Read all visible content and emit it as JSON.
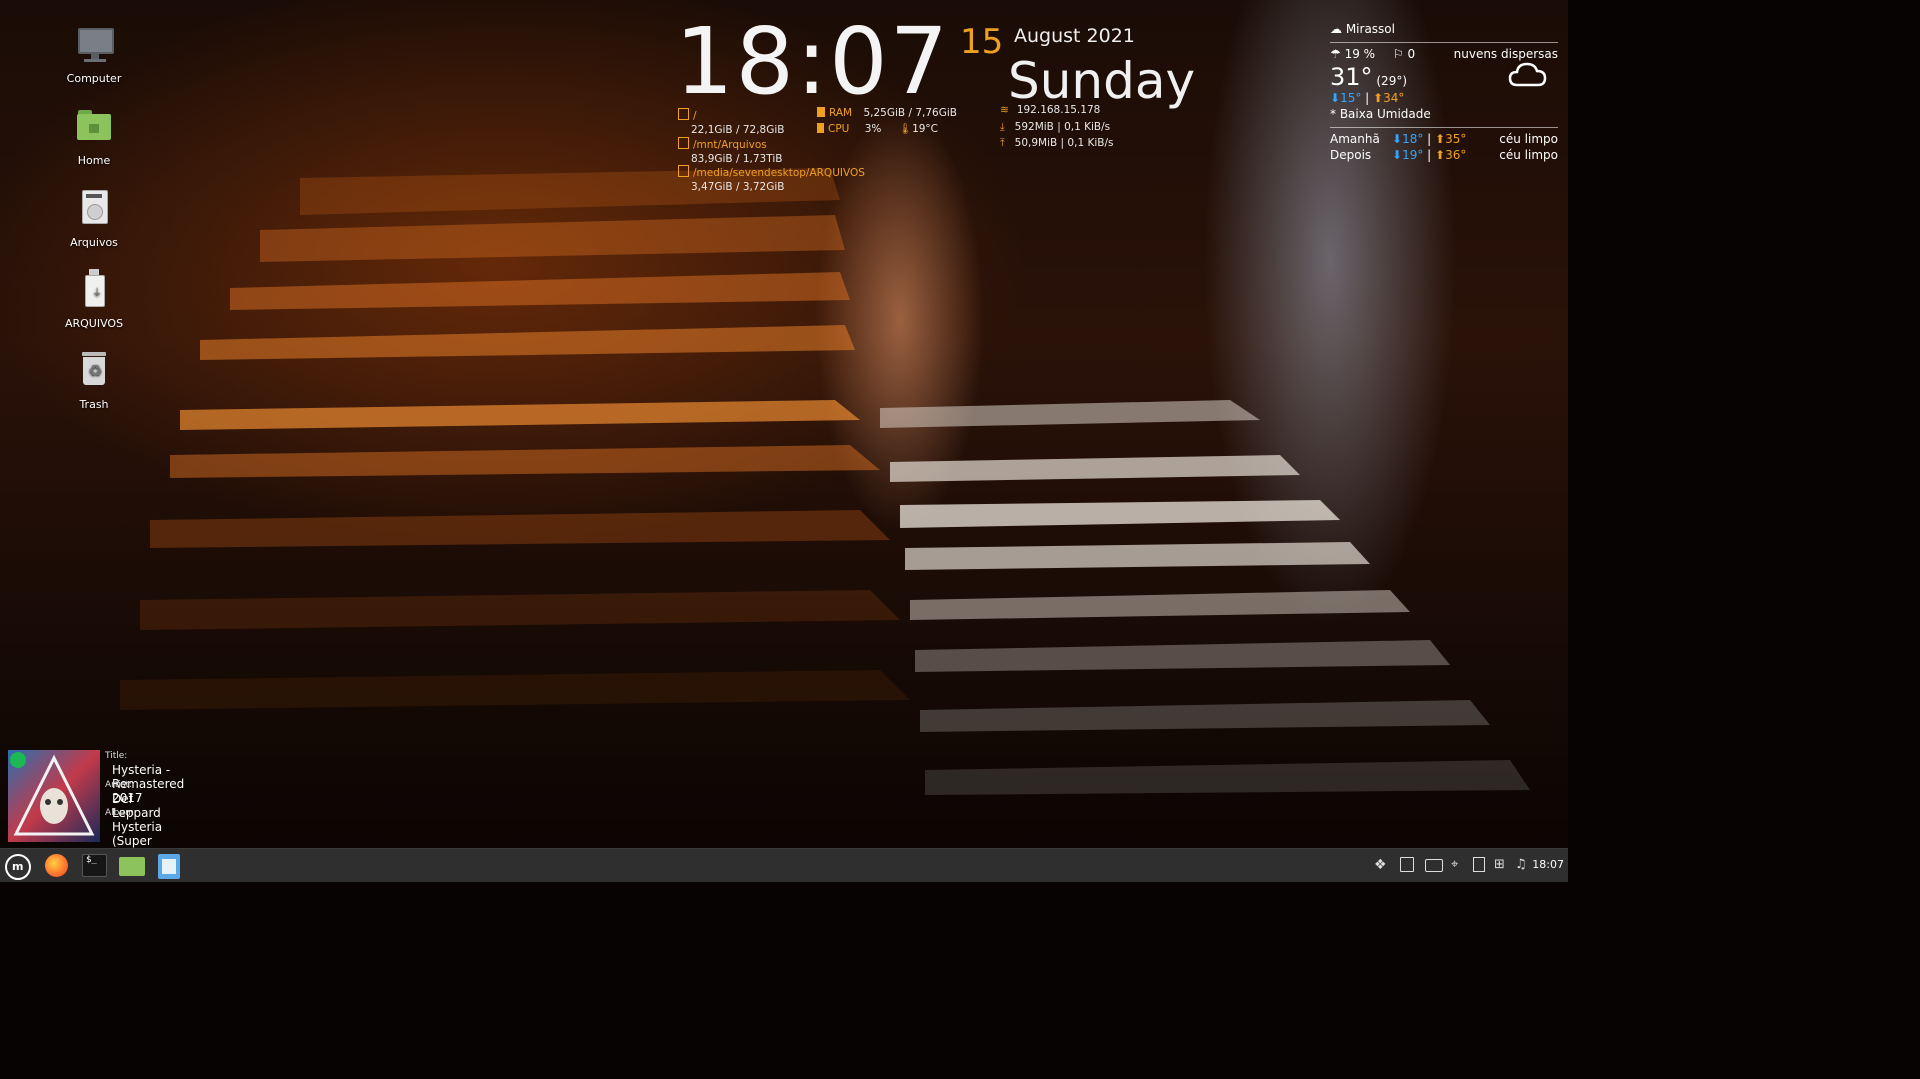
{
  "desktop": {
    "icons": [
      {
        "label": "Computer"
      },
      {
        "label": "Home"
      },
      {
        "label": "Arquivos"
      },
      {
        "label": "ARQUIVOS"
      },
      {
        "label": "Trash"
      }
    ]
  },
  "clock": {
    "time": "18:07",
    "day": "15",
    "month_year": "August 2021",
    "weekday": "Sunday"
  },
  "system": {
    "disks": [
      {
        "path": "/",
        "usage": "22,1GiB / 72,8GiB"
      },
      {
        "path": "/mnt/Arquivos",
        "usage": "83,9GiB / 1,73TiB"
      },
      {
        "path": "/media/sevendesktop/ARQUIVOS",
        "usage": "3,47GiB / 3,72GiB"
      }
    ],
    "ram_label": "RAM",
    "ram_value": "5,25GiB / 7,76GiB",
    "cpu_label": "CPU",
    "cpu_value": "3%",
    "cpu_temp": "19°C",
    "ip": "192.168.15.178",
    "download": "592MiB  |  0,1 KiB/s",
    "upload": "50,9MiB  |  0,1 KiB/s"
  },
  "weather": {
    "city": "Mirassol",
    "humidity": "19 %",
    "wind": "0",
    "description": "nuvens dispersas",
    "temp": "31°",
    "feels": "(29°)",
    "min": "15°",
    "max": "34°",
    "separator": "|",
    "note": "* Baixa Umidade",
    "forecast": [
      {
        "day": "Amanhã",
        "min": "18°",
        "max": "35°",
        "desc": "céu limpo"
      },
      {
        "day": "Depois",
        "min": "19°",
        "max": "36°",
        "desc": "céu limpo"
      }
    ]
  },
  "music": {
    "title_label": "Title:",
    "title": "Hysteria - Remastered 2017",
    "artist_label": "Artist:",
    "artist": "Def Leppard",
    "album_label": "Album:",
    "album": "Hysteria (Super Deluxe)"
  },
  "taskbar": {
    "clock": "18:07",
    "apps": [
      "menu-icon",
      "firefox-icon",
      "terminal-icon",
      "files-icon",
      "text-editor-icon"
    ]
  },
  "colors": {
    "accent": "#f0a020",
    "link_blue": "#33a6ff",
    "taskbar": "#2f2f2f"
  }
}
